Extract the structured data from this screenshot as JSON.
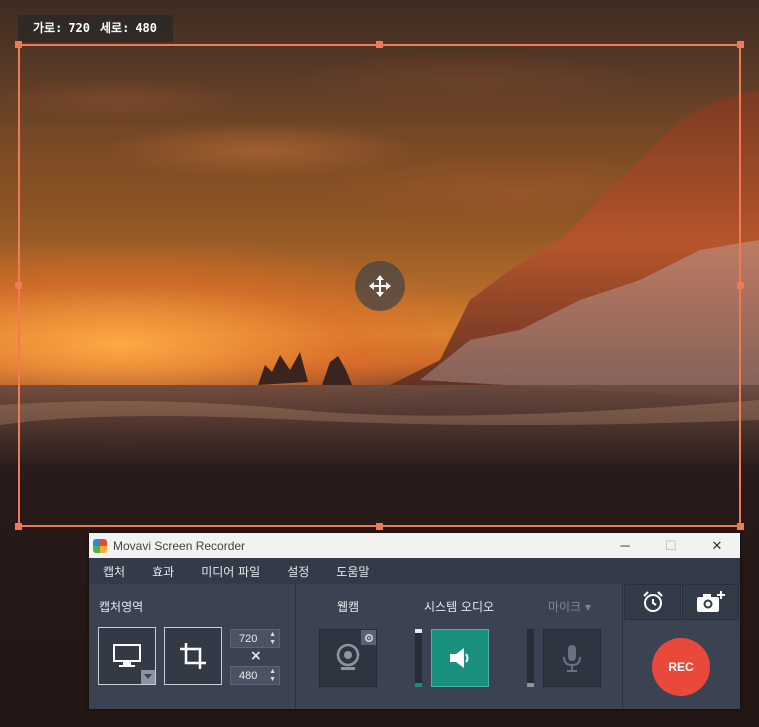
{
  "capture": {
    "width_label": "가로:",
    "width": "720",
    "height_label": "세로:",
    "height": "480"
  },
  "window": {
    "title": "Movavi Screen Recorder",
    "minimize_symbol": "─",
    "maximize_symbol": "☐",
    "close_symbol": "✕"
  },
  "menu": [
    "캡처",
    "효과",
    "미디어 파일",
    "설정",
    "도움말"
  ],
  "left_panel": {
    "label": "캡처영역",
    "width_value": "720",
    "height_value": "480",
    "times_symbol": "×",
    "spin_up": "▲",
    "spin_down": "▼"
  },
  "mid_panel": {
    "webcam_label": "웹캠",
    "audio_label": "시스템 오디오",
    "mic_label": "마이크",
    "mic_caret": "▾"
  },
  "right_panel": {
    "rec_label": "REC"
  },
  "colors": {
    "accent_teal": "#19907e",
    "rec_red": "#e9493a",
    "frame_orange": "#f07a55",
    "window_dark": "#3b4352"
  },
  "icons": {
    "screen": "monitor-icon",
    "crop": "crop-icon",
    "webcam": "webcam-icon",
    "gear": "gear-icon",
    "speaker": "speaker-icon",
    "mic": "microphone-icon",
    "alarm": "alarm-clock-icon",
    "camera": "camera-plus-icon",
    "move": "move-arrows-icon"
  }
}
